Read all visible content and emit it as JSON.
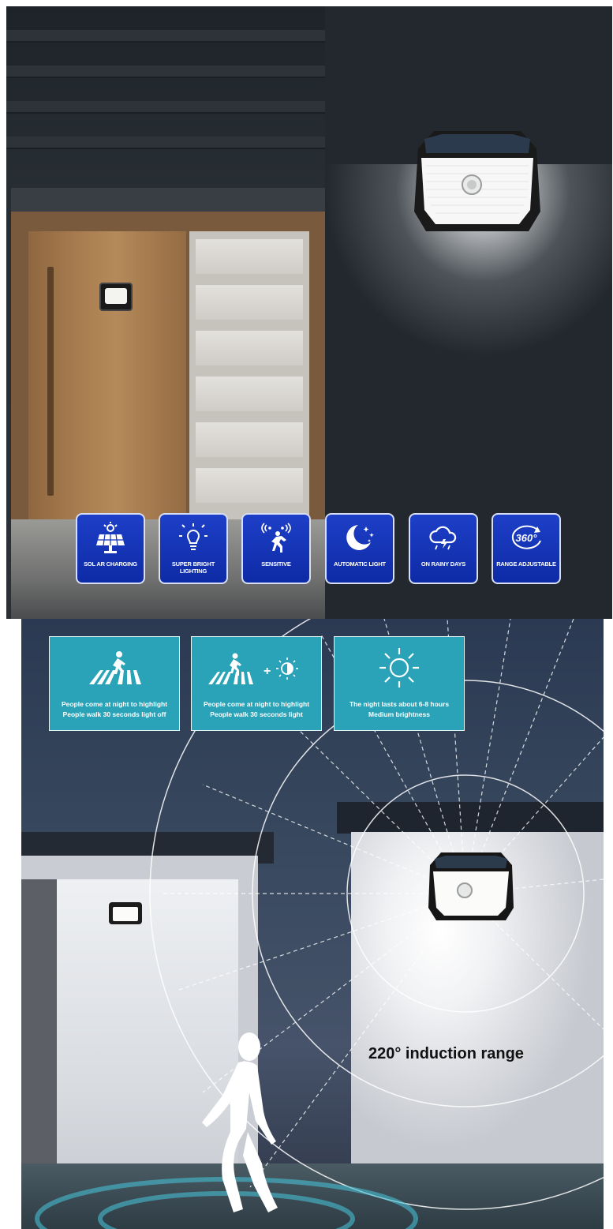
{
  "features": [
    {
      "icon": "solar-panel-icon",
      "label": "SOL AR CHARGING"
    },
    {
      "icon": "bulb-icon",
      "label": "SUPER BRIGHT LIGHTING"
    },
    {
      "icon": "motion-sensor-icon",
      "label": "SENSITIVE"
    },
    {
      "icon": "moon-stars-icon",
      "label": "AUTOMATIC LIGHT"
    },
    {
      "icon": "rain-cloud-icon",
      "label": "ON RAINY DAYS"
    },
    {
      "icon": "rotate-360-icon",
      "label": "RANGE ADJUSTABLE",
      "icon_text": "360°"
    }
  ],
  "modes": [
    {
      "icon": "pedestrian-crossing-icon",
      "line1": "People come at night to highlight",
      "line2": "People walk 30 seconds light off"
    },
    {
      "icon": "pedestrian-plus-dim-icon",
      "line1": "People come at night to highlight",
      "line2": "People walk 30 seconds light"
    },
    {
      "icon": "sun-icon",
      "line1": "The night lasts about 6-8 hours",
      "line2": "Medium brightness"
    }
  ],
  "induction_label": "220° induction range",
  "colors": {
    "feature_blue": "#1533b8",
    "card_teal": "#2aa3b8"
  }
}
